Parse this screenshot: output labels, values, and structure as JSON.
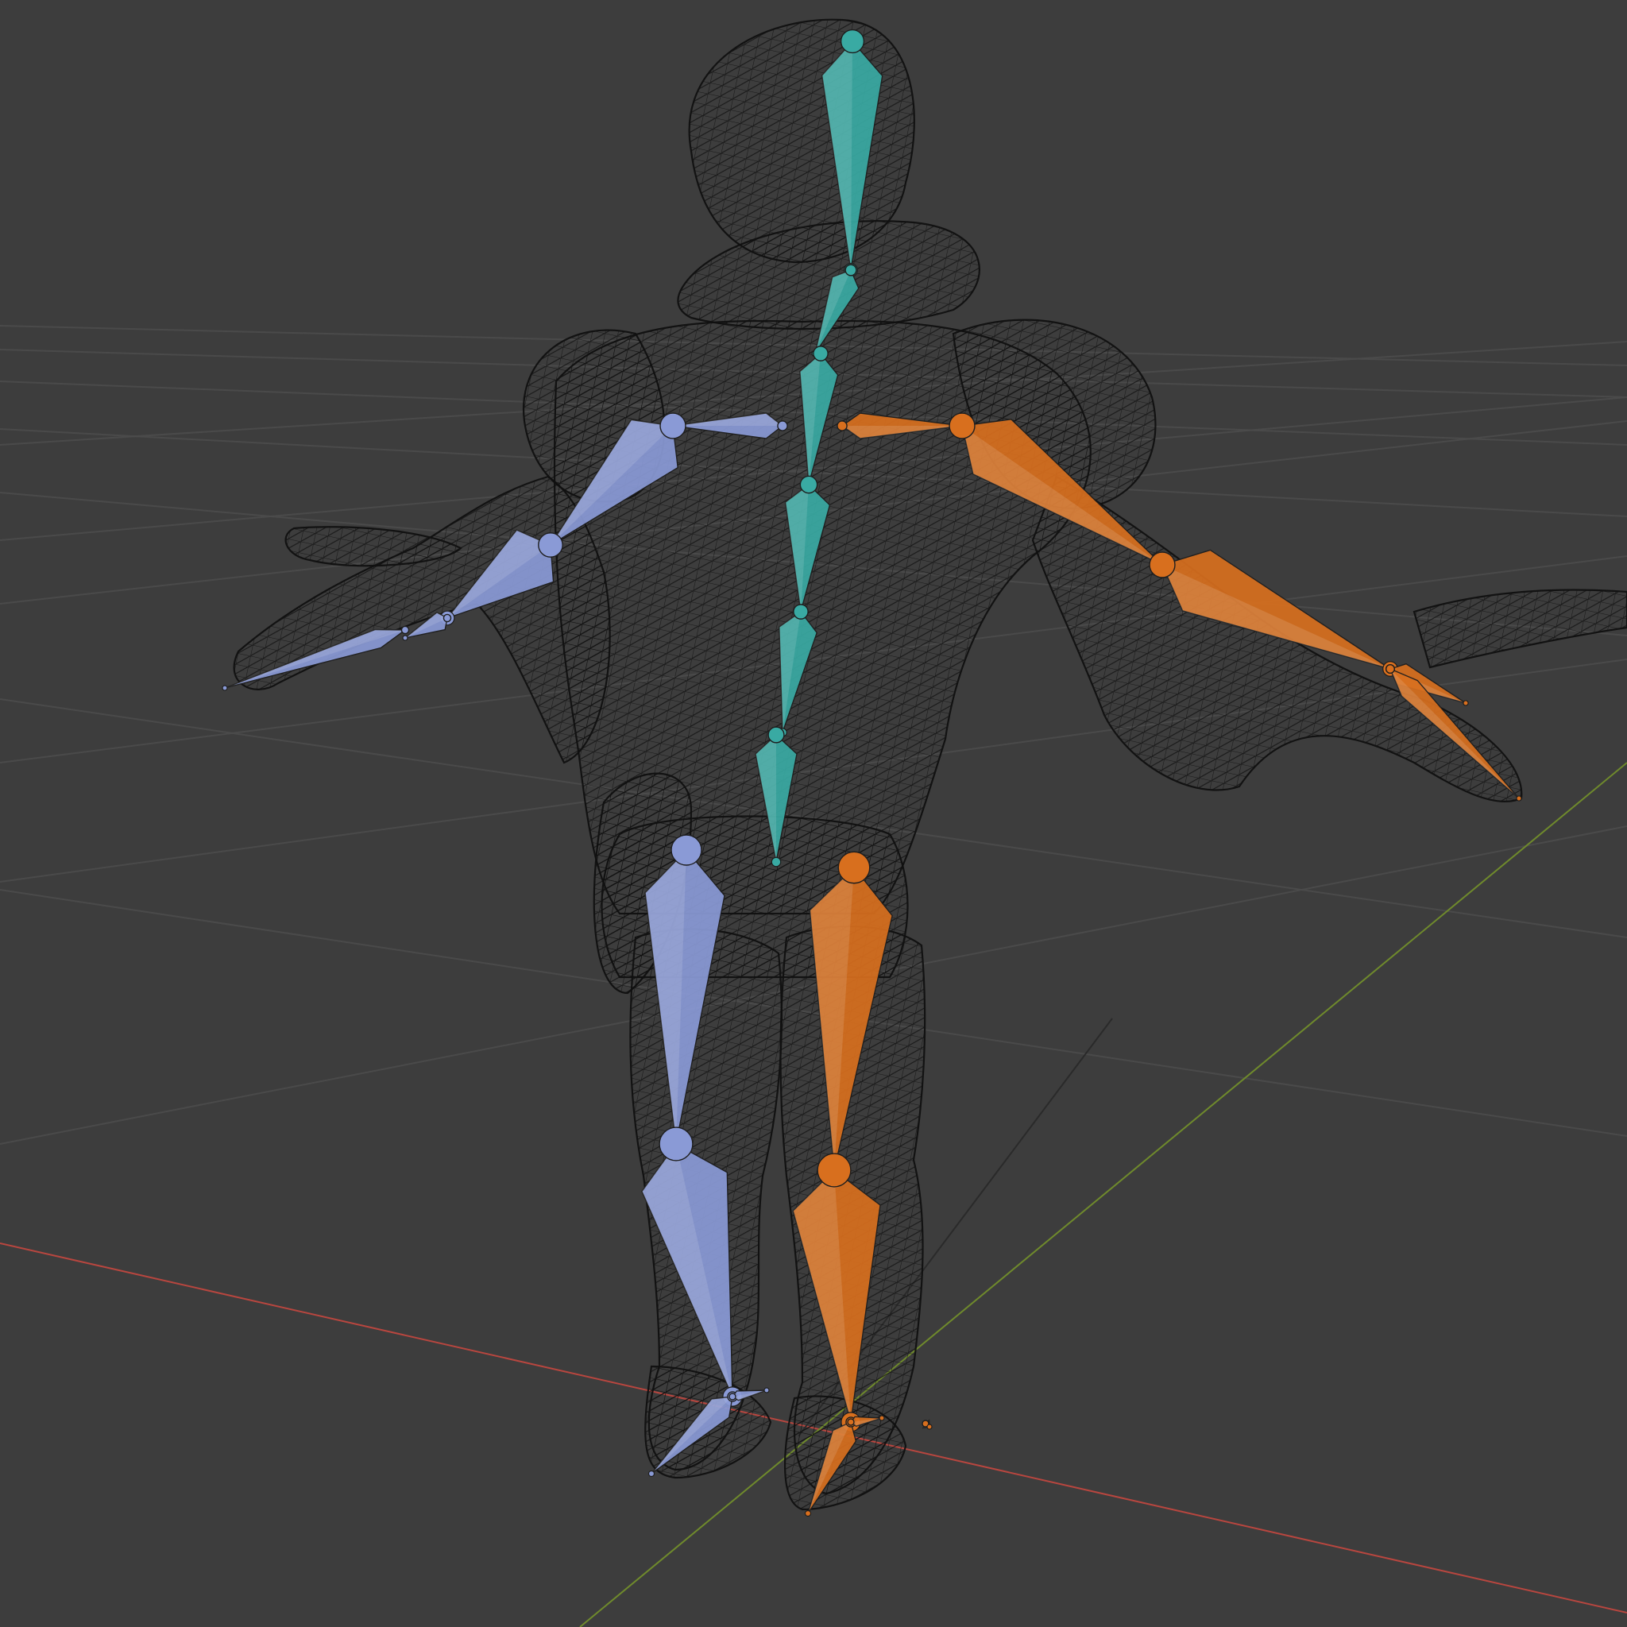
{
  "viewport": {
    "mode": "3d-viewport",
    "shading": "wireframe",
    "background_color": "#3d3d3d",
    "grid_color": "#4c4c4c",
    "axis_x_color": "#b8463f",
    "axis_y_color": "#6f8a2c",
    "axis_z_color": "#2a2a2a"
  },
  "mesh": {
    "name": "character-mesh",
    "wire_color": "#101010"
  },
  "armature": {
    "center_color": "#39aaa3",
    "left_color": "#8a9ad6",
    "right_color": "#d86f1e",
    "selected_outline": "#ff9b4a",
    "groups": [
      {
        "side": "center",
        "bones": [
          "head",
          "neck",
          "spine-3",
          "spine-2",
          "spine-1",
          "hips"
        ]
      },
      {
        "side": "left",
        "bones": [
          "shoulder",
          "upper-arm",
          "forearm",
          "hand",
          "finger",
          "thigh",
          "shin",
          "foot",
          "toe"
        ]
      },
      {
        "side": "right",
        "bones": [
          "shoulder",
          "upper-arm",
          "forearm",
          "hand",
          "finger",
          "thigh",
          "shin",
          "foot",
          "toe"
        ]
      }
    ]
  }
}
